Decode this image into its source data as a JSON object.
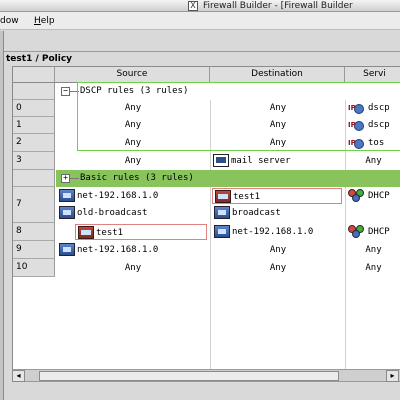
{
  "window": {
    "title": "Firewall Builder - [Firewall Builder",
    "title_icon_glyph": "X"
  },
  "menubar": {
    "items": [
      {
        "label_pre": "",
        "label_u": "",
        "label_post": "dow"
      },
      {
        "label_pre": "",
        "label_u": "H",
        "label_post": "elp"
      }
    ]
  },
  "panel": {
    "title": "test1 / Policy"
  },
  "table": {
    "columns": [
      "Source",
      "Destination",
      "Servi"
    ],
    "groups": {
      "dscp": {
        "expander": "−",
        "label": "DSCP rules (3 rules)"
      },
      "basic": {
        "expander": "+",
        "label": "Basic rules (3 rules)"
      }
    },
    "rows": [
      {
        "num": "0",
        "source": "Any",
        "destination": "Any",
        "service": "dscp",
        "service_icon": "ip-service-icon"
      },
      {
        "num": "1",
        "source": "Any",
        "destination": "Any",
        "service": "dscp",
        "service_icon": "ip-service-icon"
      },
      {
        "num": "2",
        "source": "Any",
        "destination": "Any",
        "service": "tos",
        "service_icon": "ip-service-icon"
      },
      {
        "num": "3",
        "source": "Any",
        "destination": "mail server",
        "service": "Any",
        "destination_icon": "host-icon"
      },
      {
        "num": "7",
        "source_lines": [
          "net-192.168.1.0",
          "old-broadcast"
        ],
        "destination_lines": [
          "test1",
          "broadcast"
        ],
        "service": "DHCP"
      },
      {
        "num": "8",
        "source": "test1",
        "destination": "net-192.168.1.0",
        "service": "DHCP"
      },
      {
        "num": "9",
        "source": "net-192.168.1.0",
        "destination": "Any",
        "service": "Any"
      },
      {
        "num": "10",
        "source": "Any",
        "destination": "Any",
        "service": "Any"
      }
    ]
  },
  "scrollbar": {
    "left": "◂",
    "right": "▸"
  },
  "colors": {
    "group_basic": "#88c35c",
    "group_dscp_border": "#6fd14a",
    "selected_border": "#e08080"
  }
}
